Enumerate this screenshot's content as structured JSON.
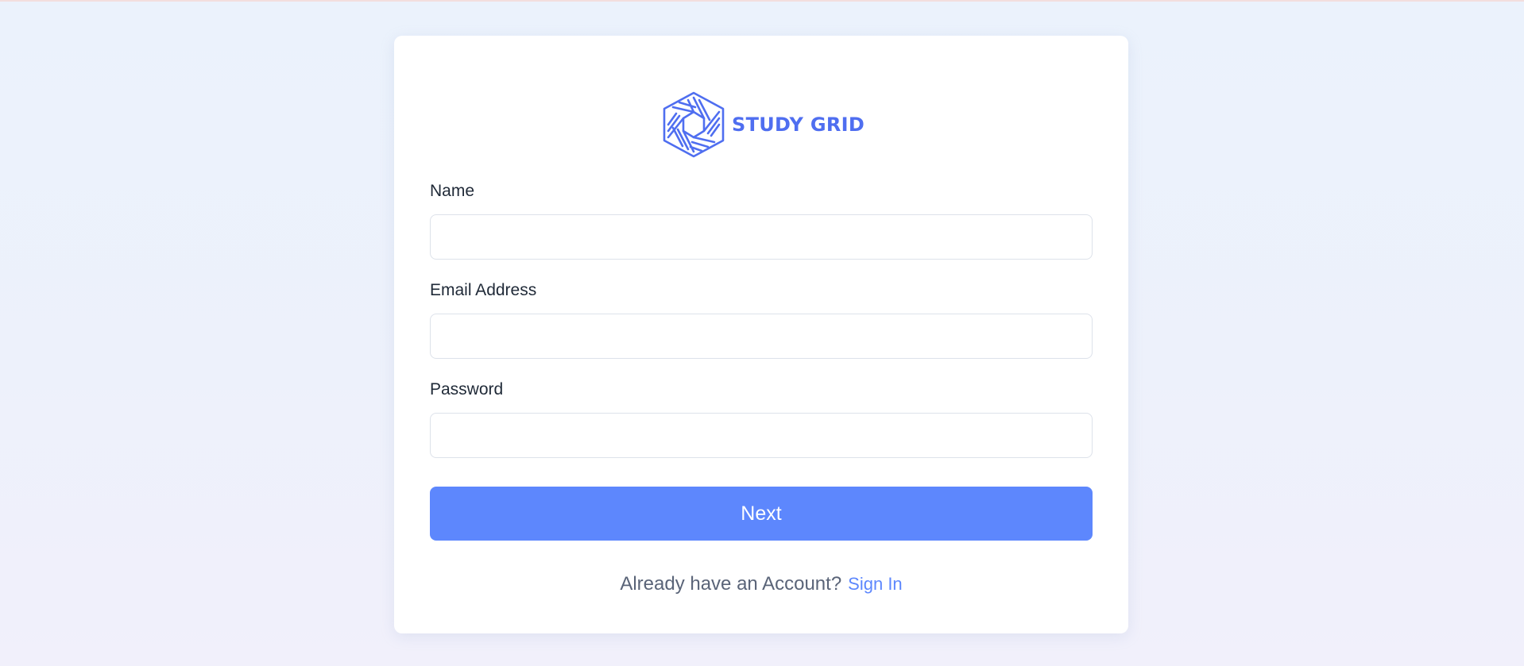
{
  "brand": {
    "name": "STUDY GRID",
    "logo_icon": "hexagon-logo-icon",
    "color": "#4f6ef0"
  },
  "form": {
    "fields": [
      {
        "label": "Name",
        "value": "",
        "placeholder": ""
      },
      {
        "label": "Email Address",
        "value": "",
        "placeholder": ""
      },
      {
        "label": "Password",
        "value": "",
        "placeholder": ""
      }
    ],
    "submit_label": "Next",
    "submit_color": "#5d87fd"
  },
  "footer": {
    "prompt": "Already have an Account?",
    "link_label": "Sign In",
    "link_color": "#5d87fd"
  }
}
